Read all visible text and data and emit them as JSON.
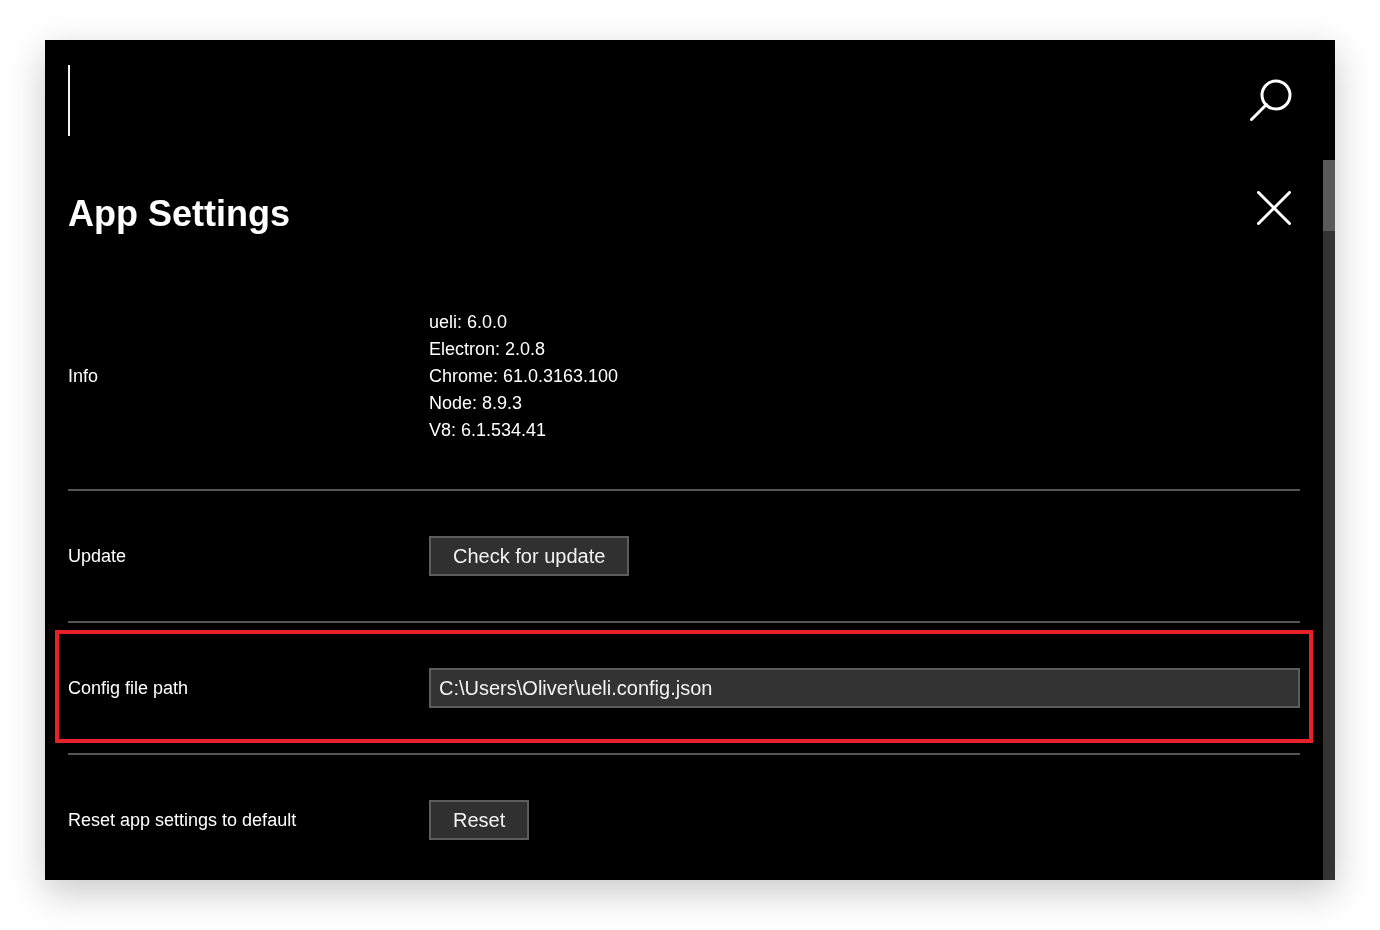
{
  "search": {
    "focused": true
  },
  "title": "App Settings",
  "settings": [
    {
      "kind": "info",
      "label": "Info",
      "lines": [
        "ueli: 6.0.0",
        "Electron: 2.0.8",
        "Chrome: 61.0.3163.100",
        "Node: 8.9.3",
        "V8: 6.1.534.41"
      ],
      "highlighted": false
    },
    {
      "kind": "button",
      "label": "Update",
      "button": "Check for update",
      "highlighted": false
    },
    {
      "kind": "field",
      "label": "Config file path",
      "value": "C:\\Users\\Oliver\\ueli.config.json",
      "highlighted": true
    },
    {
      "kind": "button",
      "label": "Reset app settings to default",
      "button": "Reset",
      "highlighted": false
    }
  ]
}
